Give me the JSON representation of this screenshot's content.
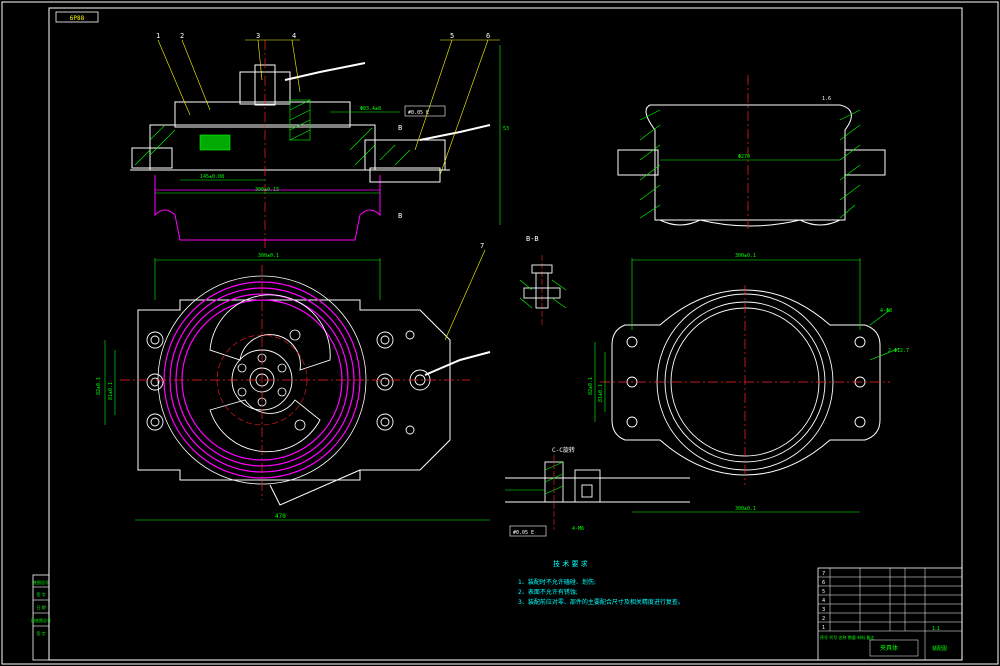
{
  "colors": {
    "background": "#000000",
    "frame": "#ffffff",
    "outline": "#ffffff",
    "center_line": "#ff2020",
    "dimension": "#00ff00",
    "hatch": "#00ff00",
    "hidden_part": "#ff00ff",
    "leader": "#ffff00",
    "notes": "#00ffff",
    "part_fill": "#00cc00"
  },
  "drawing_code": "6P88",
  "part_numbers": [
    "1",
    "2",
    "3",
    "4",
    "5",
    "6",
    "7"
  ],
  "section_labels": {
    "bb": "B-B",
    "cc": "C-C旋转",
    "b_top": "B",
    "b_bottom": "B"
  },
  "dimensions": {
    "top_ra": "Φ83.4±8",
    "top_tol": "#0.05 E",
    "top_width1": "145±0.08",
    "top_width2": "300±0.15",
    "top_height": "53",
    "main_width": "300±0.1",
    "main_total": "470",
    "main_v1": "82±0.1",
    "main_v2": "81±0.1",
    "cc_tol": "#0.05 E",
    "cc_holes": "4-M6",
    "right_dia": "Φ270",
    "right_h1": "82±0.1",
    "right_h2": "81±0.1",
    "right_w1": "300±0.1",
    "right_w2": "300±0.1",
    "right_hole1": "4-Φ8",
    "right_hole2": "2-Φ12.7",
    "ra_right": "1.6"
  },
  "tech_req": {
    "title": "技 术 要 求",
    "items": [
      "1、装配时不允许磕碰、划伤;",
      "2、表面不允许有锈蚀;",
      "3、装配前应对零、部件的主要配合尺寸及相关精度进行复查。"
    ]
  },
  "side_labels": [
    "底图总号",
    "签 字",
    "日 期",
    "旧底图总号",
    "签 字"
  ],
  "title_block": {
    "name": "夹具体",
    "subtitle": "装配图",
    "row_labels": [
      "7",
      "6",
      "5",
      "4",
      "3",
      "2",
      "1"
    ],
    "header": "序号 代号 名称 数量 材料 备注",
    "scale": "1:1"
  }
}
